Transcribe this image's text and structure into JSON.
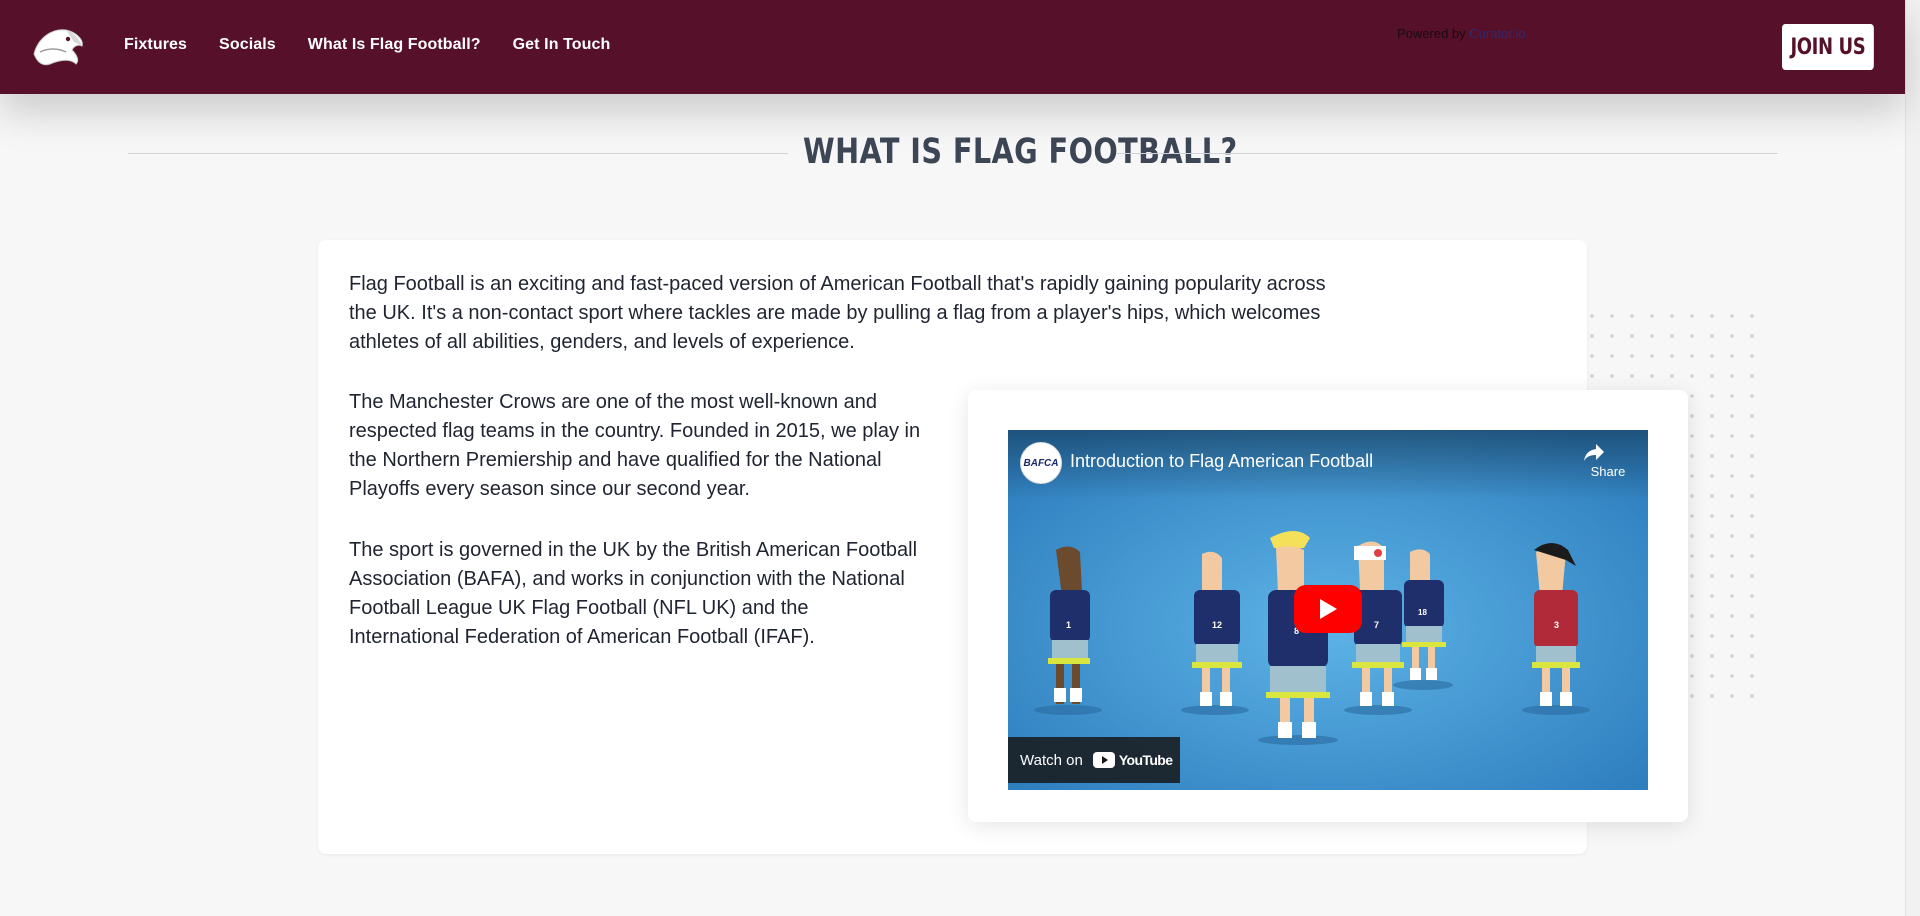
{
  "header": {
    "logo_icon": "crow-head-logo",
    "nav": [
      {
        "label": "Fixtures"
      },
      {
        "label": "Socials"
      },
      {
        "label": "What Is Flag Football?"
      },
      {
        "label": "Get In Touch"
      }
    ],
    "powered_by": "Powered by",
    "curator": "Curator.io",
    "join_label": "JOIN US",
    "bg_color": "#561029"
  },
  "section": {
    "title": "What is flag football?"
  },
  "content": {
    "paragraph1": "Flag Football is an exciting and fast-paced version of American Football that's rapidly gaining popularity across the UK. It's a non-contact sport where tackles are made by pulling a flag from a player's hips, which welcomes athletes of all abilities, genders, and levels of experience.",
    "paragraph2": "The Manchester Crows are one of the most well-known and respected flag teams in the country. Founded in 2015, we play in the Northern Premiership and have qualified for the National Playoffs every season since our second year.",
    "paragraph3": "The sport is governed in the UK by the British American Football Association (BAFA), and works in conjunction with the National Football League UK Flag Football (NFL UK) and the International Federation of American Football (IFAF)."
  },
  "video": {
    "channel_avatar_text": "BAFCA",
    "title": "Introduction to Flag American Football",
    "share_label": "Share",
    "watch_on": "Watch on",
    "youtube": "YouTube",
    "player_numbers": [
      "1",
      "12",
      "8",
      "7",
      "18",
      "3"
    ]
  }
}
